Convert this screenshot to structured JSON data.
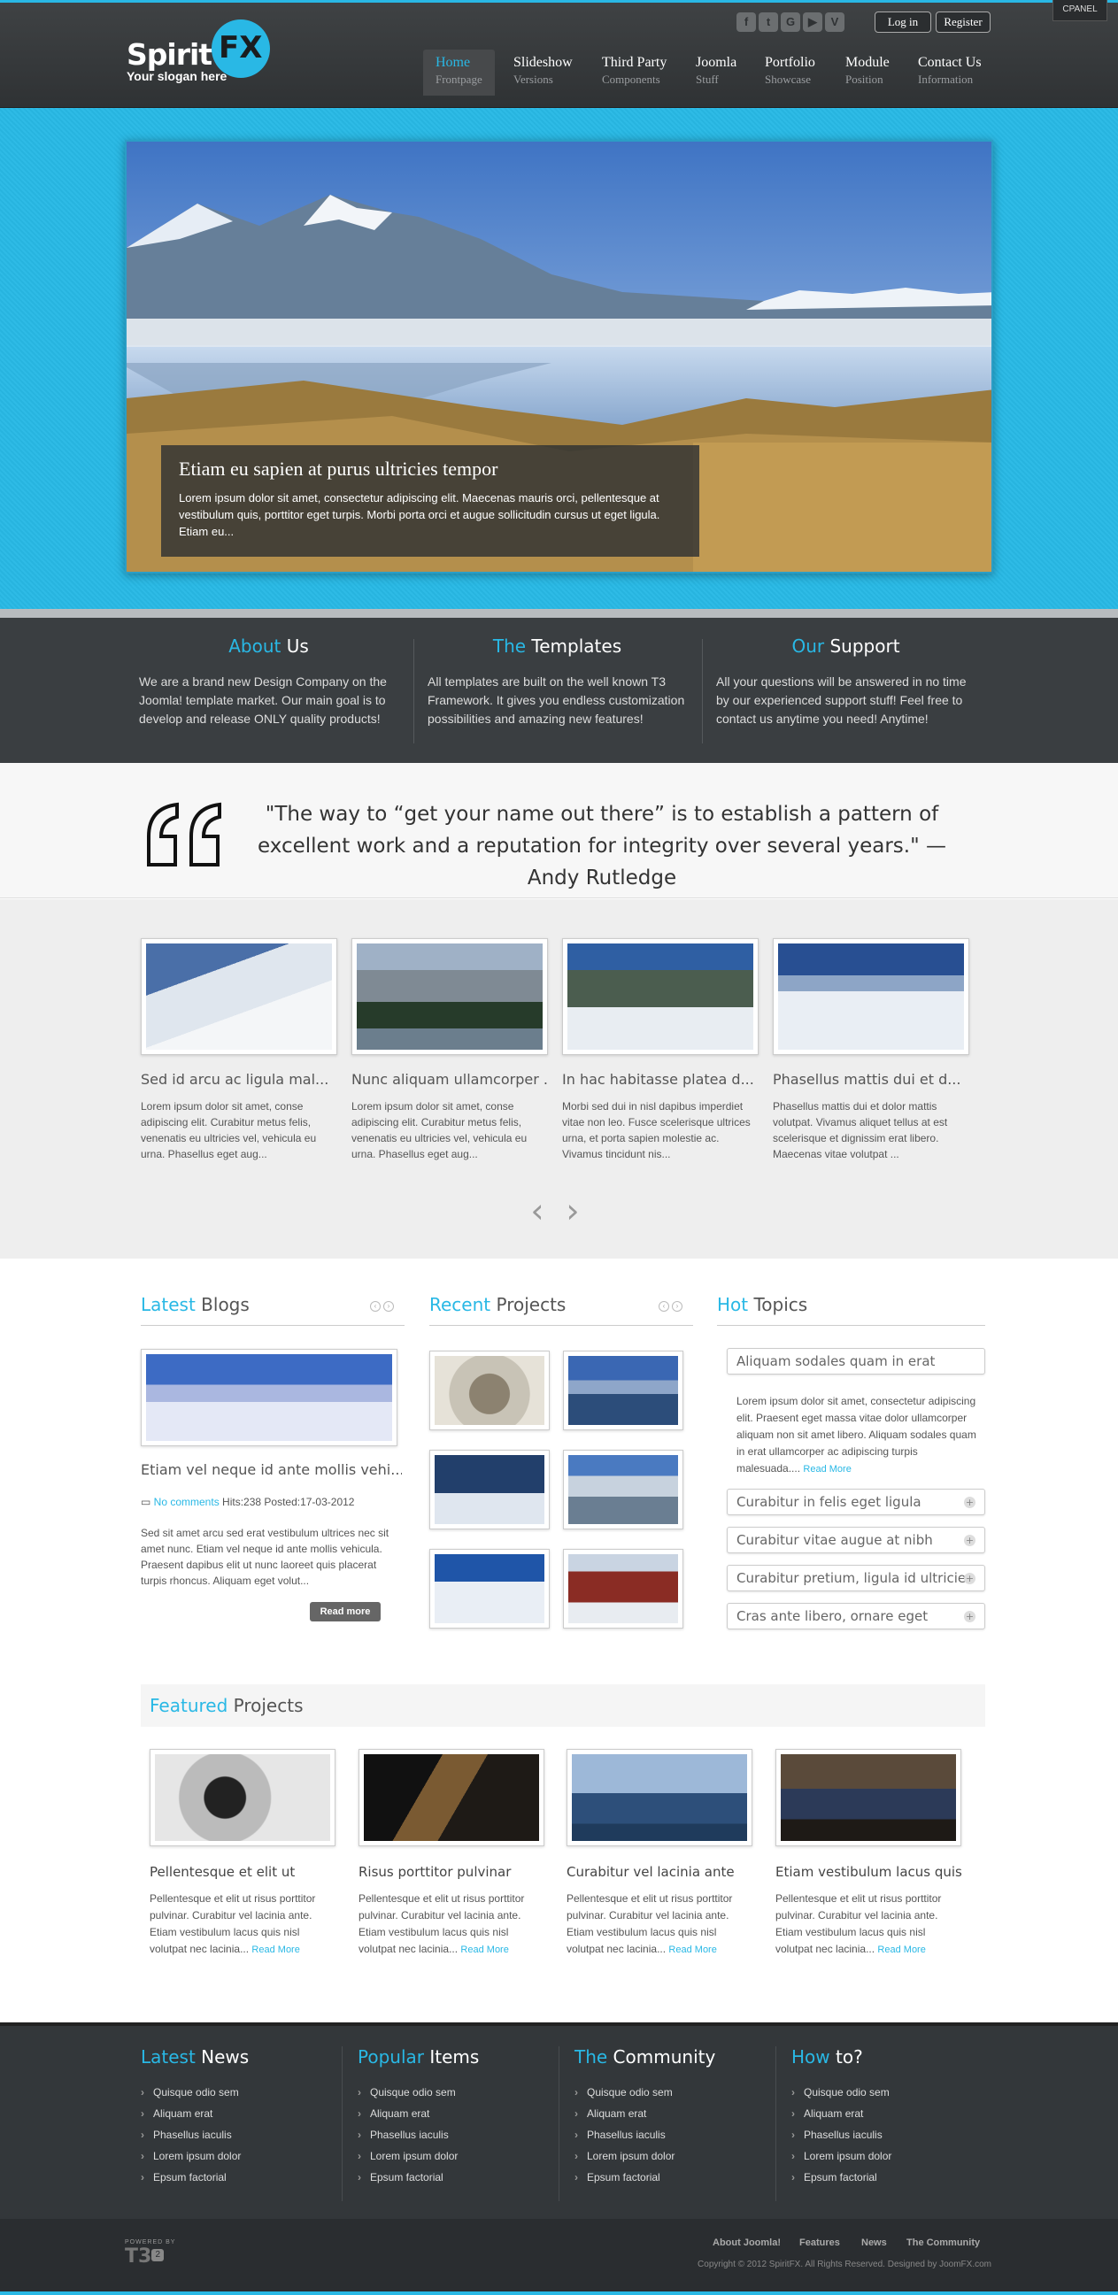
{
  "header": {
    "cpanel": "CPANEL",
    "logo": {
      "spirit": "Spirit",
      "fx": "FX",
      "slogan": "Your slogan here"
    },
    "social": [
      {
        "icon": "facebook-icon",
        "glyph": "f"
      },
      {
        "icon": "twitter-icon",
        "glyph": "t"
      },
      {
        "icon": "google-icon",
        "glyph": "G"
      },
      {
        "icon": "youtube-icon",
        "glyph": "▶"
      },
      {
        "icon": "vimeo-icon",
        "glyph": "V"
      }
    ],
    "login": "Log in",
    "register": "Register",
    "nav": [
      {
        "title": "Home",
        "sub": "Frontpage"
      },
      {
        "title": "Slideshow",
        "sub": "Versions"
      },
      {
        "title": "Third Party",
        "sub": "Components"
      },
      {
        "title": "Joomla",
        "sub": "Stuff"
      },
      {
        "title": "Portfolio",
        "sub": "Showcase"
      },
      {
        "title": "Module",
        "sub": "Position"
      },
      {
        "title": "Contact Us",
        "sub": "Information"
      }
    ]
  },
  "slideshow": {
    "caption_title": "Etiam eu sapien at purus ultricies tempor",
    "caption_text": "Lorem ipsum dolor sit amet, consectetur adipiscing elit. Maecenas mauris orci, pellentesque at vestibulum quis, porttitor eget turpis. Morbi porta orci et augue sollicitudin cursus ut eget ligula. Etiam eu..."
  },
  "about": [
    {
      "accent": "About",
      "rest": " Us",
      "text": "We are a brand new Design Company on the Joomla! template market. Our main goal is to develop and release ONLY quality products!"
    },
    {
      "accent": "The",
      "rest": " Templates",
      "text": "All templates are built on the well known T3 Framework. It gives you endless customization possibilities and amazing new features!"
    },
    {
      "accent": "Our",
      "rest": " Support",
      "text": "All your questions will be answered in no time by our experienced support stuff! Feel free to contact us anytime you need! Anytime!"
    }
  ],
  "quote": "\"The way to “get your name out there” is to establish a pattern of excellent work and a reputation for integrity over several years.\" — Andy Rutledge",
  "gallery": [
    {
      "title": "Sed id arcu ac ligula mal...",
      "text": "Lorem ipsum dolor sit amet, conse adipiscing elit. Curabitur metus felis, venenatis eu ultricies vel, vehicula eu urna. Phasellus eget aug..."
    },
    {
      "title": "Nunc aliquam ullamcorper ...",
      "text": "Lorem ipsum dolor sit amet, conse adipiscing elit. Curabitur metus felis, venenatis eu ultricies vel, vehicula eu urna. Phasellus eget aug..."
    },
    {
      "title": "In hac habitasse platea d...",
      "text": "Morbi sed dui in nisl dapibus imperdiet vitae non leo. Fusce scelerisque ultrices urna, et porta sapien molestie ac. Vivamus tincidunt nis..."
    },
    {
      "title": "Phasellus mattis dui et d...",
      "text": "Phasellus mattis dui et dolor mattis volutpat. Vivamus aliquet tellus at est scelerisque et dignissim erat libero. Maecenas vitae volutpat ..."
    }
  ],
  "latest_blogs": {
    "accent": "Latest",
    "rest": " Blogs",
    "post_title": "Etiam vel neque id ante mollis vehi...",
    "comments": "No comments",
    "meta": " Hits:238 Posted:17-03-2012",
    "text": "Sed sit amet arcu sed erat vestibulum ultrices nec sit amet nunc. Etiam vel neque id ante mollis vehicula. Praesent dapibus elit ut nunc laoreet quis placerat turpis rhoncus. Aliquam eget volut...",
    "read_more": "Read more"
  },
  "recent_projects": {
    "accent": "Recent",
    "rest": " Projects"
  },
  "hot_topics": {
    "accent": "Hot",
    "rest": " Topics",
    "open_item": "Aliquam sodales quam in erat",
    "open_text": "Lorem ipsum dolor sit amet, consectetur adipiscing elit. Praesent eget massa vitae dolor ullamcorper aliquam non sit amet libero. Aliquam sodales quam in erat ullamcorper ac adipiscing turpis malesuada....",
    "read_more": "Read More",
    "items": [
      "Curabitur in felis eget ligula",
      "Curabitur vitae augue at nibh",
      "Curabitur pretium, ligula id ultricies",
      "Cras ante libero, ornare eget"
    ]
  },
  "featured": {
    "accent": "Featured",
    "rest": " Projects",
    "items": [
      {
        "title": "Pellentesque et elit ut",
        "text": "Pellentesque et elit ut risus porttitor pulvinar. Curabitur vel lacinia ante. Etiam vestibulum lacus quis nisl volutpat nec lacinia...",
        "more": "Read More"
      },
      {
        "title": "Risus porttitor pulvinar",
        "text": "Pellentesque et elit ut risus porttitor pulvinar. Curabitur vel lacinia ante. Etiam vestibulum lacus quis nisl volutpat nec lacinia...",
        "more": "Read More"
      },
      {
        "title": "Curabitur vel lacinia ante",
        "text": "Pellentesque et elit ut risus porttitor pulvinar. Curabitur vel lacinia ante. Etiam vestibulum lacus quis nisl volutpat nec lacinia...",
        "more": "Read More"
      },
      {
        "title": "Etiam vestibulum lacus quis",
        "text": "Pellentesque et elit ut risus porttitor pulvinar. Curabitur vel lacinia ante. Etiam vestibulum lacus quis nisl volutpat nec lacinia...",
        "more": "Read More"
      }
    ]
  },
  "footer": {
    "columns": [
      {
        "accent": "Latest",
        "rest": " News",
        "links": [
          "Quisque odio sem",
          "Aliquam erat",
          "Phasellus iaculis",
          "Lorem ipsum dolor",
          "Epsum factorial"
        ]
      },
      {
        "accent": "Popular",
        "rest": " Items",
        "links": [
          "Quisque odio sem",
          "Aliquam erat",
          "Phasellus iaculis",
          "Lorem ipsum dolor",
          "Epsum factorial"
        ]
      },
      {
        "accent": "The",
        "rest": " Community",
        "links": [
          "Quisque odio sem",
          "Aliquam erat",
          "Phasellus iaculis",
          "Lorem ipsum dolor",
          "Epsum factorial"
        ]
      },
      {
        "accent": "How",
        "rest": " to?",
        "links": [
          "Quisque odio sem",
          "Aliquam erat",
          "Phasellus iaculis",
          "Lorem ipsum dolor",
          "Epsum factorial"
        ]
      }
    ],
    "powered": "POWERED BY",
    "t3": "T3",
    "t3_version": "2",
    "links": [
      "About Joomla!",
      "Features",
      "News",
      "The Community"
    ],
    "copyright": "Copyright © 2012 SpiritFX. All Rights Reserved. Designed by JoomFX.com"
  },
  "colors": {
    "accent": "#29b8e5",
    "header": "#33373a",
    "dark_band": "#3a3e41"
  }
}
